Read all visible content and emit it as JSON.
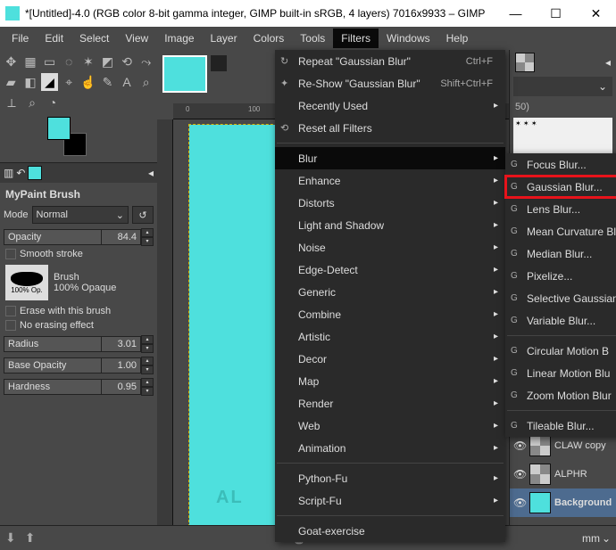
{
  "titlebar": {
    "text": "*[Untitled]-4.0 (RGB color 8-bit gamma integer, GIMP built-in sRGB, 4 layers) 7016x9933 – GIMP",
    "minimize": "—",
    "maximize": "☐",
    "close": "✕"
  },
  "menubar": {
    "items": [
      "File",
      "Edit",
      "Select",
      "View",
      "Image",
      "Layer",
      "Colors",
      "Tools",
      "Filters",
      "Windows",
      "Help"
    ],
    "active_index": 8
  },
  "tool_options": {
    "title": "MyPaint Brush",
    "mode_label": "Mode",
    "mode_value": "Normal",
    "opacity_label": "Opacity",
    "opacity_value": "84.4",
    "smooth_stroke": "Smooth stroke",
    "brush_section": "Brush",
    "brush_thumb_label": "100% Op.",
    "brush_name": "100% Opaque",
    "erase_label": "Erase with this brush",
    "no_erasing_label": "No erasing effect",
    "radius_label": "Radius",
    "radius_value": "3.01",
    "base_opacity_label": "Base Opacity",
    "base_opacity_value": "1.00",
    "hardness_label": "Hardness",
    "hardness_value": "0.95"
  },
  "ruler": {
    "m0": "0",
    "m100": "100"
  },
  "canvas": {
    "watermark": "AL"
  },
  "filters_menu": {
    "repeat": "Repeat \"Gaussian Blur\"",
    "repeat_accel": "Ctrl+F",
    "reshow": "Re-Show \"Gaussian Blur\"",
    "reshow_accel": "Shift+Ctrl+F",
    "recent": "Recently Used",
    "reset": "Reset all Filters",
    "groups": [
      "Blur",
      "Enhance",
      "Distorts",
      "Light and Shadow",
      "Noise",
      "Edge-Detect",
      "Generic",
      "Combine",
      "Artistic",
      "Decor",
      "Map",
      "Render",
      "Web",
      "Animation"
    ],
    "py": "Python-Fu",
    "script": "Script-Fu",
    "goat": "Goat-exercise"
  },
  "blur_submenu": {
    "items": [
      "Focus Blur...",
      "Gaussian Blur...",
      "Lens Blur...",
      "Mean Curvature Bl",
      "Median Blur...",
      "Pixelize...",
      "Selective Gaussian",
      "Variable Blur..."
    ],
    "section2": [
      "Circular Motion B",
      "Linear Motion Blu",
      "Zoom Motion Blur"
    ],
    "section3": [
      "Tileable Blur..."
    ],
    "highlighted_index": 1
  },
  "right_panel": {
    "preview_label": "50)",
    "layers": [
      {
        "name": "CLAW copy",
        "thumb": "checker"
      },
      {
        "name": "ALPHR",
        "thumb": "checker"
      },
      {
        "name": "Background",
        "thumb": "cyan",
        "selected": true
      }
    ]
  },
  "statusbar": {
    "unit": "mm"
  }
}
